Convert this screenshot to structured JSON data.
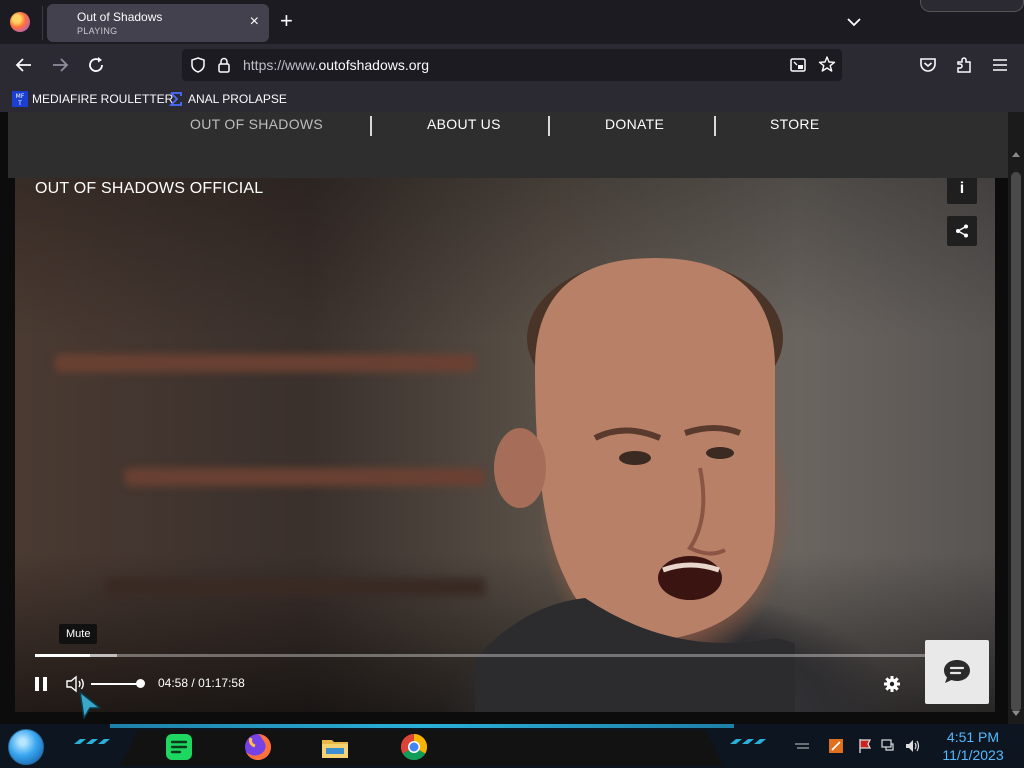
{
  "browser": {
    "tab": {
      "title": "Out of Shadows",
      "subtitle": "PLAYING",
      "close_icon": "×"
    },
    "new_tab_icon": "+",
    "url": {
      "prefix": "https://www.",
      "domain": "outofshadows.org"
    },
    "bookmarks": [
      {
        "label": "MEDIAFIRE ROULETTER",
        "icon": "mediafire-icon"
      },
      {
        "label": "ANAL PROLAPSE",
        "icon": "sigma-icon"
      }
    ]
  },
  "site": {
    "nav": [
      "OUT OF SHADOWS",
      "ABOUT US",
      "DONATE",
      "STORE"
    ]
  },
  "video": {
    "title": "OUT OF SHADOWS OFFICIAL",
    "info_icon": "i",
    "tooltip": "Mute",
    "current_time": "04:58",
    "separator": "/",
    "duration": "01:17:58",
    "progress_fraction": 0.062,
    "buffered_fraction": 0.092,
    "volume_fraction": 1.0
  },
  "taskbar": {
    "time": "4:51 PM",
    "date": "11/1/2023"
  },
  "colors": {
    "browser_dark": "#1c1b22",
    "browser_toolbar": "#2b2a33",
    "tab_active": "#42414d",
    "site_nav": "#2e2e2e",
    "clock_blue": "#54b9ff"
  }
}
